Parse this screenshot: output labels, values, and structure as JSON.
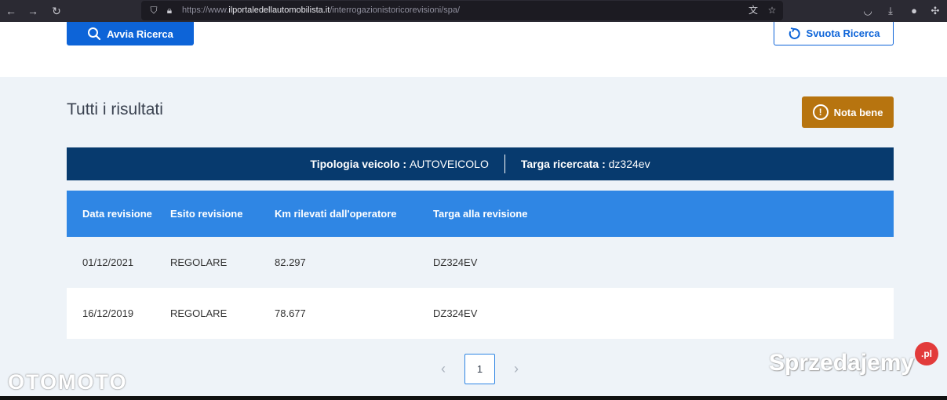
{
  "browser": {
    "url_prefix": "https://www.",
    "url_domain": "ilportaledellautomobilista.it",
    "url_path": "/interrogazionistoricorevisioni/spa/"
  },
  "search": {
    "search_button": "Avvia Ricerca",
    "reset_button": "Svuota Ricerca"
  },
  "results": {
    "title": "Tutti i risultati",
    "note_button": "Nota bene",
    "vehicle_type_label": "Tipologia veicolo :",
    "vehicle_type_value": "AUTOVEICOLO",
    "plate_label": "Targa ricercata :",
    "plate_value": "dz324ev",
    "columns": [
      "Data revisione",
      "Esito revisione",
      "Km rilevati dall'operatore",
      "Targa alla revisione"
    ],
    "rows": [
      [
        "01/12/2021",
        "REGOLARE",
        "82.297",
        "DZ324EV"
      ],
      [
        "16/12/2019",
        "REGOLARE",
        "78.677",
        "DZ324EV"
      ]
    ]
  },
  "pagination": {
    "prev": "‹",
    "current": "1",
    "next": "›"
  },
  "watermarks": {
    "left": "OTOMOTO",
    "right": "Sprzedajemy",
    "badge": ".pl"
  },
  "colors": {
    "primary_blue": "#0d64d8",
    "dark_navy": "#073a6e",
    "table_header": "#2f86e4",
    "warning_orange": "#b7740f"
  }
}
